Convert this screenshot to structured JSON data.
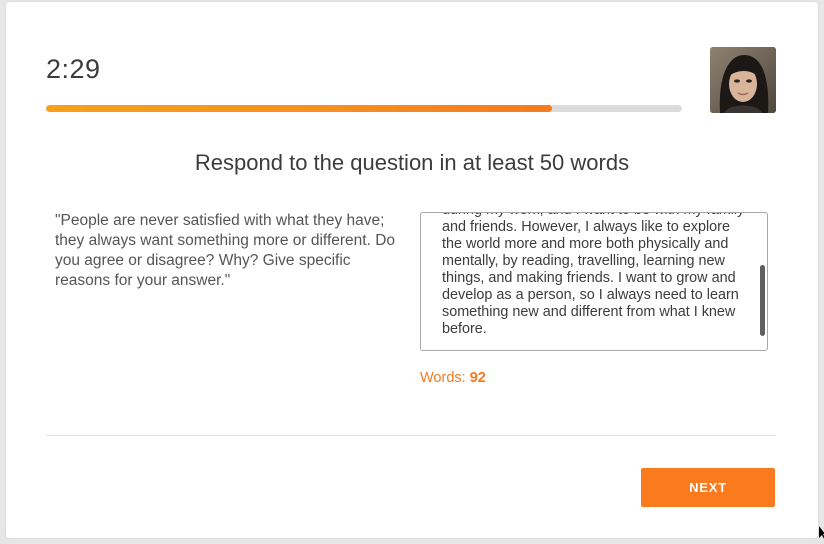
{
  "timer": {
    "remaining": "2:29"
  },
  "progress": {
    "fraction": 0.795,
    "fill_color": "#f7921f",
    "track_color": "#dcdcdc"
  },
  "webcam": {
    "icon": "user-webcam-avatar"
  },
  "prompt": {
    "heading": "Respond to the question in at least 50 words",
    "question": "\"People are never satisfied with what they have; they always want something more or different. Do you agree or disagree? Why? Give specific reasons for your answer.\""
  },
  "answer": {
    "text": "during my work, and I want to be with my family and friends. However, I always like to explore the world more and more both physically and mentally, by reading, travelling, learning new things, and making friends. I want to grow and develop as a person, so I always need to learn something new and different from what I knew before."
  },
  "word_count": {
    "label": "Words:",
    "value": "92",
    "color": "#f47b20"
  },
  "footer": {
    "next_label": "NEXT",
    "next_color": "#fa7a1e"
  }
}
